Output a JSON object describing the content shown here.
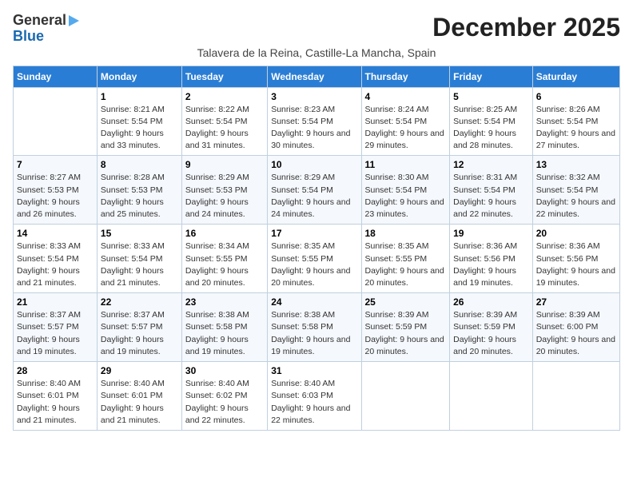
{
  "logo": {
    "line1": "General",
    "line2": "Blue"
  },
  "title": "December 2025",
  "subtitle": "Talavera de la Reina, Castille-La Mancha, Spain",
  "headers": [
    "Sunday",
    "Monday",
    "Tuesday",
    "Wednesday",
    "Thursday",
    "Friday",
    "Saturday"
  ],
  "weeks": [
    [
      {
        "day": "",
        "sunrise": "",
        "sunset": "",
        "daylight": ""
      },
      {
        "day": "1",
        "sunrise": "Sunrise: 8:21 AM",
        "sunset": "Sunset: 5:54 PM",
        "daylight": "Daylight: 9 hours and 33 minutes."
      },
      {
        "day": "2",
        "sunrise": "Sunrise: 8:22 AM",
        "sunset": "Sunset: 5:54 PM",
        "daylight": "Daylight: 9 hours and 31 minutes."
      },
      {
        "day": "3",
        "sunrise": "Sunrise: 8:23 AM",
        "sunset": "Sunset: 5:54 PM",
        "daylight": "Daylight: 9 hours and 30 minutes."
      },
      {
        "day": "4",
        "sunrise": "Sunrise: 8:24 AM",
        "sunset": "Sunset: 5:54 PM",
        "daylight": "Daylight: 9 hours and 29 minutes."
      },
      {
        "day": "5",
        "sunrise": "Sunrise: 8:25 AM",
        "sunset": "Sunset: 5:54 PM",
        "daylight": "Daylight: 9 hours and 28 minutes."
      },
      {
        "day": "6",
        "sunrise": "Sunrise: 8:26 AM",
        "sunset": "Sunset: 5:54 PM",
        "daylight": "Daylight: 9 hours and 27 minutes."
      }
    ],
    [
      {
        "day": "7",
        "sunrise": "Sunrise: 8:27 AM",
        "sunset": "Sunset: 5:53 PM",
        "daylight": "Daylight: 9 hours and 26 minutes."
      },
      {
        "day": "8",
        "sunrise": "Sunrise: 8:28 AM",
        "sunset": "Sunset: 5:53 PM",
        "daylight": "Daylight: 9 hours and 25 minutes."
      },
      {
        "day": "9",
        "sunrise": "Sunrise: 8:29 AM",
        "sunset": "Sunset: 5:53 PM",
        "daylight": "Daylight: 9 hours and 24 minutes."
      },
      {
        "day": "10",
        "sunrise": "Sunrise: 8:29 AM",
        "sunset": "Sunset: 5:54 PM",
        "daylight": "Daylight: 9 hours and 24 minutes."
      },
      {
        "day": "11",
        "sunrise": "Sunrise: 8:30 AM",
        "sunset": "Sunset: 5:54 PM",
        "daylight": "Daylight: 9 hours and 23 minutes."
      },
      {
        "day": "12",
        "sunrise": "Sunrise: 8:31 AM",
        "sunset": "Sunset: 5:54 PM",
        "daylight": "Daylight: 9 hours and 22 minutes."
      },
      {
        "day": "13",
        "sunrise": "Sunrise: 8:32 AM",
        "sunset": "Sunset: 5:54 PM",
        "daylight": "Daylight: 9 hours and 22 minutes."
      }
    ],
    [
      {
        "day": "14",
        "sunrise": "Sunrise: 8:33 AM",
        "sunset": "Sunset: 5:54 PM",
        "daylight": "Daylight: 9 hours and 21 minutes."
      },
      {
        "day": "15",
        "sunrise": "Sunrise: 8:33 AM",
        "sunset": "Sunset: 5:54 PM",
        "daylight": "Daylight: 9 hours and 21 minutes."
      },
      {
        "day": "16",
        "sunrise": "Sunrise: 8:34 AM",
        "sunset": "Sunset: 5:55 PM",
        "daylight": "Daylight: 9 hours and 20 minutes."
      },
      {
        "day": "17",
        "sunrise": "Sunrise: 8:35 AM",
        "sunset": "Sunset: 5:55 PM",
        "daylight": "Daylight: 9 hours and 20 minutes."
      },
      {
        "day": "18",
        "sunrise": "Sunrise: 8:35 AM",
        "sunset": "Sunset: 5:55 PM",
        "daylight": "Daylight: 9 hours and 20 minutes."
      },
      {
        "day": "19",
        "sunrise": "Sunrise: 8:36 AM",
        "sunset": "Sunset: 5:56 PM",
        "daylight": "Daylight: 9 hours and 19 minutes."
      },
      {
        "day": "20",
        "sunrise": "Sunrise: 8:36 AM",
        "sunset": "Sunset: 5:56 PM",
        "daylight": "Daylight: 9 hours and 19 minutes."
      }
    ],
    [
      {
        "day": "21",
        "sunrise": "Sunrise: 8:37 AM",
        "sunset": "Sunset: 5:57 PM",
        "daylight": "Daylight: 9 hours and 19 minutes."
      },
      {
        "day": "22",
        "sunrise": "Sunrise: 8:37 AM",
        "sunset": "Sunset: 5:57 PM",
        "daylight": "Daylight: 9 hours and 19 minutes."
      },
      {
        "day": "23",
        "sunrise": "Sunrise: 8:38 AM",
        "sunset": "Sunset: 5:58 PM",
        "daylight": "Daylight: 9 hours and 19 minutes."
      },
      {
        "day": "24",
        "sunrise": "Sunrise: 8:38 AM",
        "sunset": "Sunset: 5:58 PM",
        "daylight": "Daylight: 9 hours and 19 minutes."
      },
      {
        "day": "25",
        "sunrise": "Sunrise: 8:39 AM",
        "sunset": "Sunset: 5:59 PM",
        "daylight": "Daylight: 9 hours and 20 minutes."
      },
      {
        "day": "26",
        "sunrise": "Sunrise: 8:39 AM",
        "sunset": "Sunset: 5:59 PM",
        "daylight": "Daylight: 9 hours and 20 minutes."
      },
      {
        "day": "27",
        "sunrise": "Sunrise: 8:39 AM",
        "sunset": "Sunset: 6:00 PM",
        "daylight": "Daylight: 9 hours and 20 minutes."
      }
    ],
    [
      {
        "day": "28",
        "sunrise": "Sunrise: 8:40 AM",
        "sunset": "Sunset: 6:01 PM",
        "daylight": "Daylight: 9 hours and 21 minutes."
      },
      {
        "day": "29",
        "sunrise": "Sunrise: 8:40 AM",
        "sunset": "Sunset: 6:01 PM",
        "daylight": "Daylight: 9 hours and 21 minutes."
      },
      {
        "day": "30",
        "sunrise": "Sunrise: 8:40 AM",
        "sunset": "Sunset: 6:02 PM",
        "daylight": "Daylight: 9 hours and 22 minutes."
      },
      {
        "day": "31",
        "sunrise": "Sunrise: 8:40 AM",
        "sunset": "Sunset: 6:03 PM",
        "daylight": "Daylight: 9 hours and 22 minutes."
      },
      {
        "day": "",
        "sunrise": "",
        "sunset": "",
        "daylight": ""
      },
      {
        "day": "",
        "sunrise": "",
        "sunset": "",
        "daylight": ""
      },
      {
        "day": "",
        "sunrise": "",
        "sunset": "",
        "daylight": ""
      }
    ]
  ]
}
